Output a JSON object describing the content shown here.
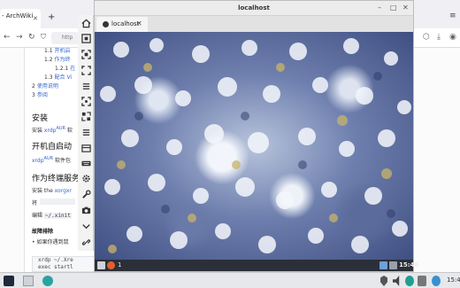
{
  "bg_browser": {
    "tab_label": "- ArchWiki",
    "tab_close": "✕",
    "new_tab": "+",
    "url_partial": "http",
    "menu": "≡",
    "toc": [
      {
        "num": "1.1",
        "text": "开机启"
      },
      {
        "num": "1.2",
        "text": "作为终"
      },
      {
        "num": "1.2.1",
        "text": "在"
      },
      {
        "num": "1.3",
        "text": "配合 Vi"
      },
      {
        "num": "2",
        "text": "使用说明"
      },
      {
        "num": "3",
        "text": "参阅"
      }
    ],
    "h_install": "安装",
    "install_line": {
      "pre": "安装 ",
      "pkg": "xrdp",
      "sup": "AUR",
      "post": " 软"
    },
    "h_autostart": "开机自启动",
    "autostart_line": {
      "pkg": "xrdp",
      "sup": "AUR",
      "post": " 软件包"
    },
    "h_terminal": "作为终端服务",
    "terminal_line": {
      "pre": "安装 the ",
      "pkg": "xorgxr"
    },
    "line_jiang": "将",
    "edit_line": {
      "pre": "编辑 ",
      "code": "~/.xinit"
    },
    "h_trouble": "故障排除",
    "bullet_line": "• 如果你遇到鼠",
    "code_lines": [
      "xrdp ~/.Xre",
      "exec startl"
    ]
  },
  "toolbar": {
    "buttons": [
      "home-icon",
      "fullscreen-icon",
      "scale-icon",
      "fit-window-icon",
      "menu-icon",
      "grab-icon",
      "shrink-icon",
      "menu-icon",
      "screenshot-icon",
      "keyboard-icon",
      "settings-icon",
      "tools-icon",
      "camera-icon",
      "chevron-down-icon",
      "disconnect-icon"
    ]
  },
  "remote_window": {
    "title": "localhost",
    "tab_label": "localhost",
    "tab_close": "✕",
    "minimize": "–",
    "maximize": "□",
    "close": "✕",
    "taskbar": {
      "count": "1",
      "clock": "15:46"
    }
  },
  "host_taskbar": {
    "clock": "15:4"
  },
  "colors": {
    "toolbar_bg": "#f3f3f3",
    "remote_taskbar_bg": "#2b2f38",
    "host_taskbar_bg": "#e6e8ec",
    "link": "#3366cc"
  }
}
